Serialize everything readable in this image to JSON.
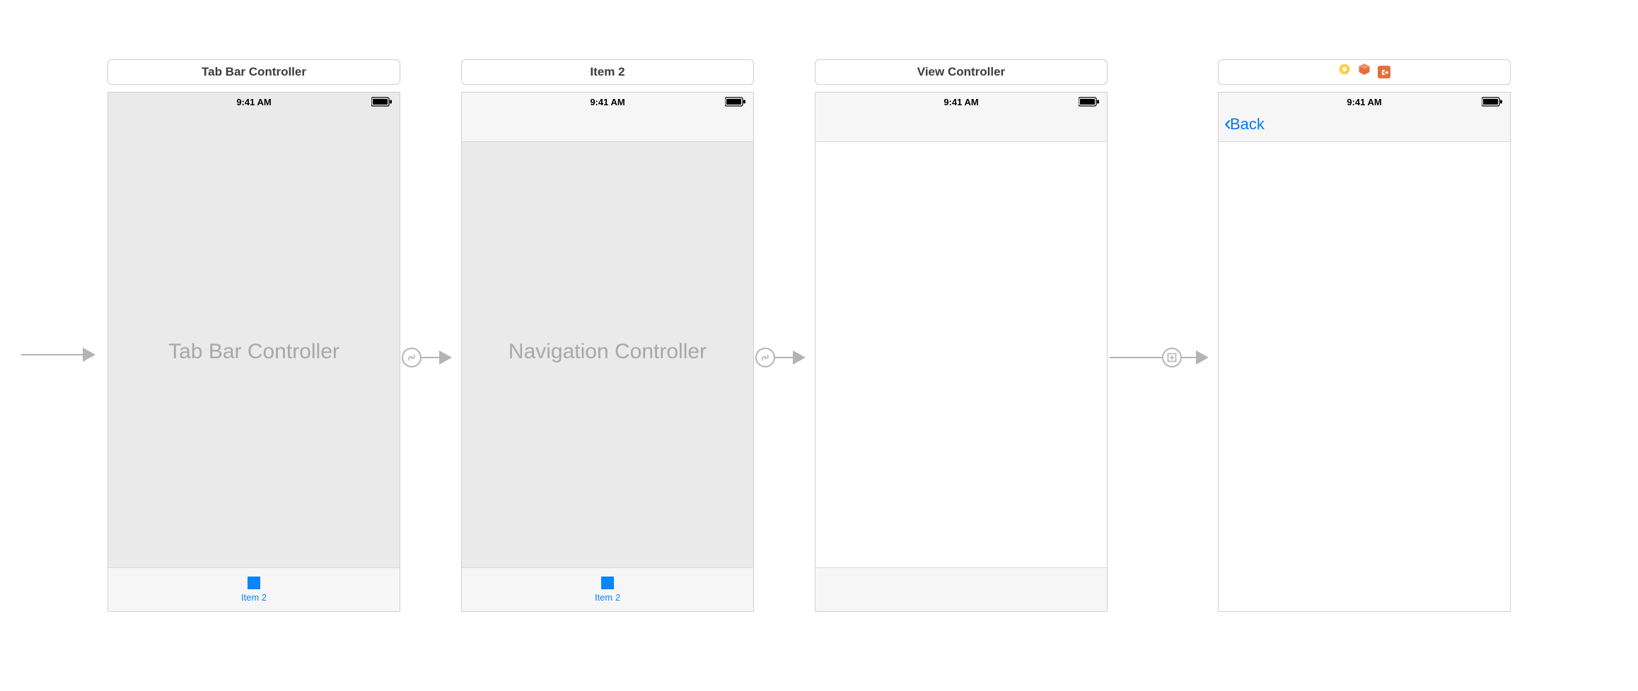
{
  "status_time": "9:41 AM",
  "scenes": {
    "tabbar": {
      "title": "Tab Bar Controller",
      "center_label": "Tab Bar Controller",
      "tab_item_label": "Item 2"
    },
    "navctrl": {
      "title": "Item 2",
      "center_label": "Navigation Controller",
      "tab_item_label": "Item 2"
    },
    "viewctrl": {
      "title": "View Controller"
    },
    "detail": {
      "back_label": "Back"
    }
  }
}
